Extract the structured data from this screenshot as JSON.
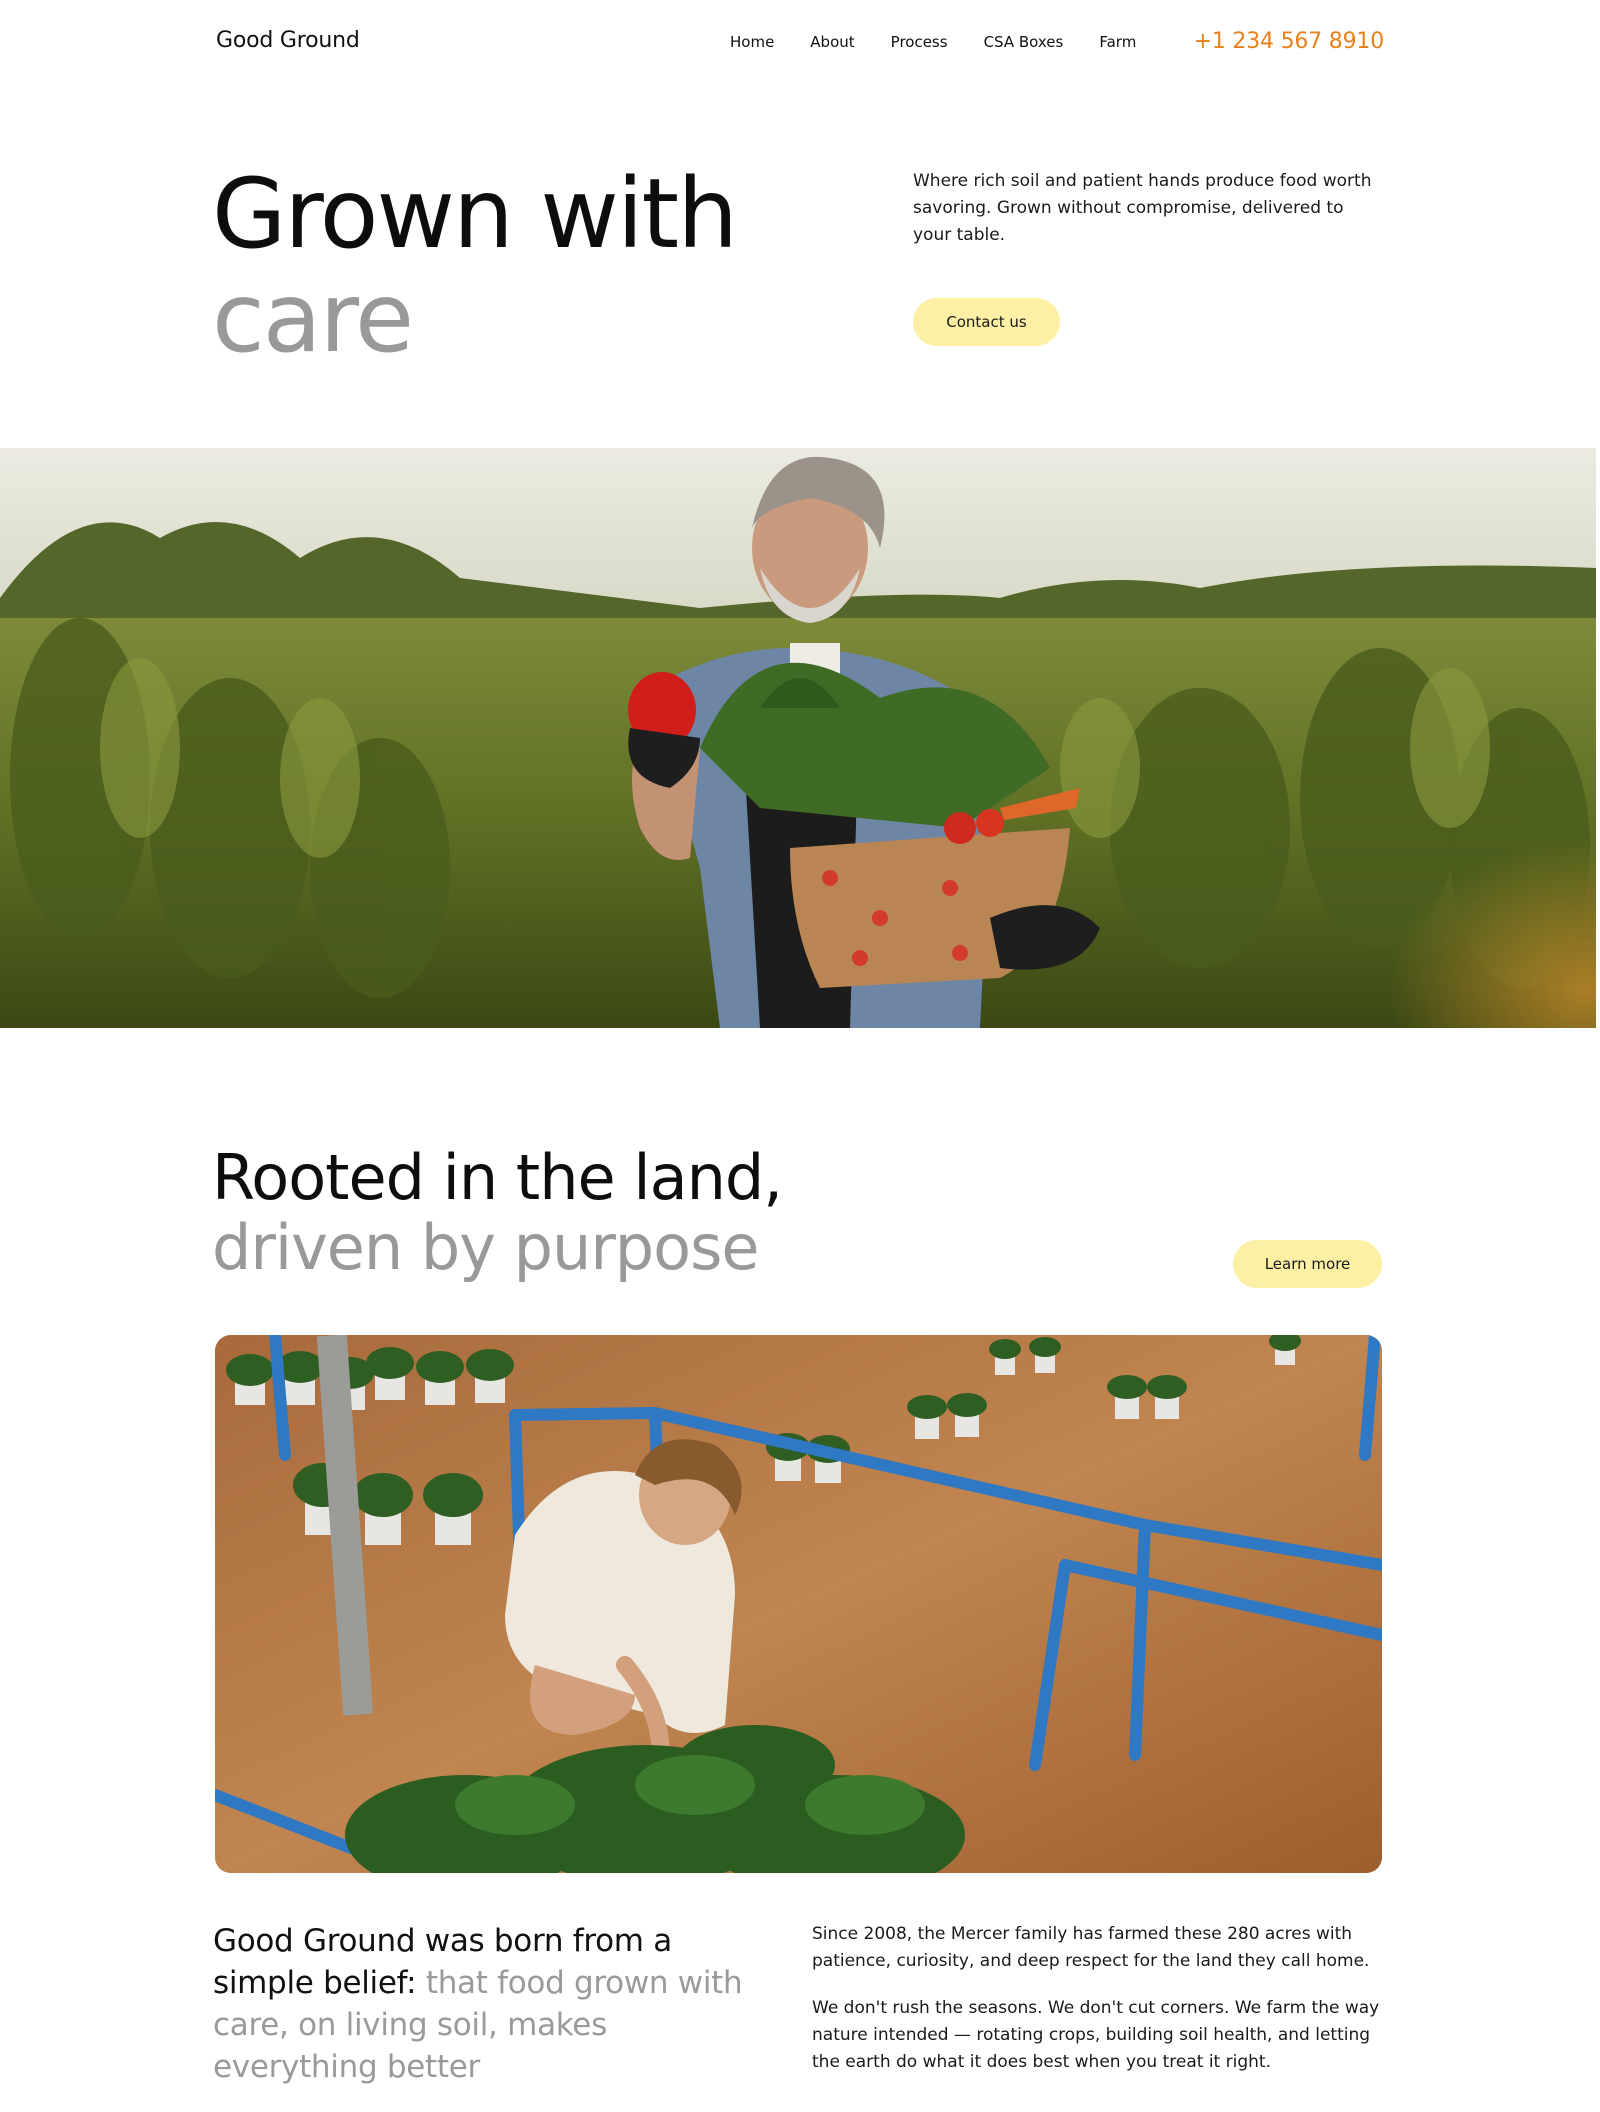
{
  "header": {
    "logo": "Good Ground",
    "nav": [
      "Home",
      "About",
      "Process",
      "CSA Boxes",
      "Farm"
    ],
    "phone": "+1 234 567 8910"
  },
  "hero": {
    "title_line1": "Grown with",
    "title_line2": "care",
    "description": "Where rich soil and patient hands produce food worth savoring. Grown without compromise, delivered to your table.",
    "cta_label": "Contact us"
  },
  "section_about": {
    "title_line1": "Rooted in the land,",
    "title_line2": "driven by purpose",
    "cta_label": "Learn more",
    "belief_dark": "Good Ground was born from a simple belief:",
    "belief_muted": "that food grown with care, on living soil, makes everything better",
    "paragraph1": "Since 2008, the Mercer family has farmed these 280 acres with patience, curiosity, and deep respect for the land they call home.",
    "paragraph2": "We don't rush the seasons. We don't cut corners. We farm the way nature intended — rotating crops, building soil health, and letting the earth do what it does best when you treat it right."
  },
  "colors": {
    "accent_phone": "#e8811c",
    "button_bg": "#fdf0a4",
    "muted_text": "#999999"
  }
}
